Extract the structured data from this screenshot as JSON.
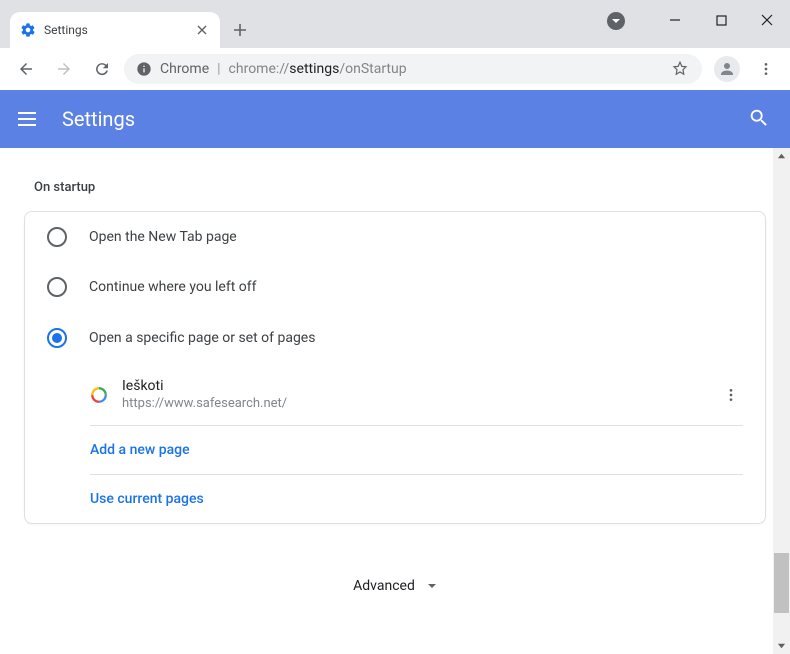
{
  "window": {
    "tab_title": "Settings"
  },
  "omnibox": {
    "origin": "Chrome",
    "url": "chrome://settings/onStartup",
    "url_prefix": "chrome://",
    "url_host": "settings",
    "url_path": "/onStartup"
  },
  "header": {
    "title": "Settings"
  },
  "section": {
    "title": "On startup"
  },
  "radios": {
    "newtab": "Open the New Tab page",
    "continue": "Continue where you left off",
    "specific": "Open a specific page or set of pages"
  },
  "pages": [
    {
      "title": "Ieškoti",
      "url": "https://www.safesearch.net/"
    }
  ],
  "actions": {
    "add": "Add a new page",
    "use_current": "Use current pages"
  },
  "footer": {
    "advanced": "Advanced"
  }
}
